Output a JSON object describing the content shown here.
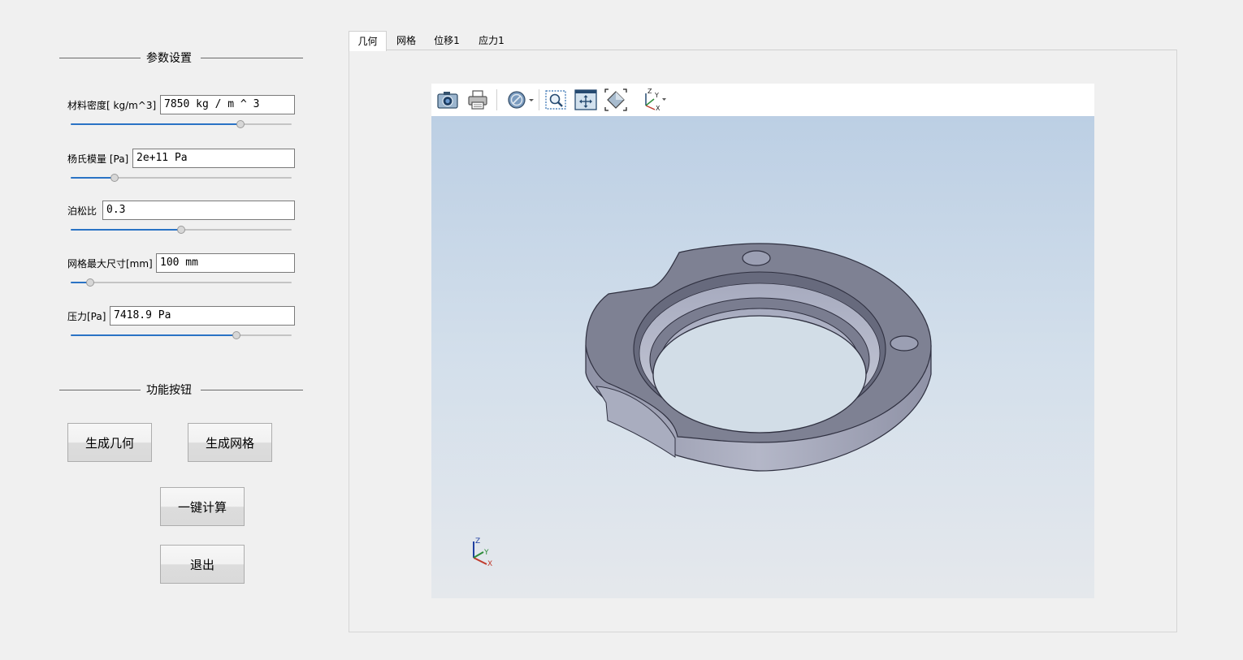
{
  "params_group": {
    "title": "参数设置"
  },
  "params": [
    {
      "label": "材料密度[ kg/m^3]",
      "value": "7850 kg / m ^ 3",
      "slider_fraction": 0.77
    },
    {
      "label": "杨氏模量 [Pa]",
      "value": "2e+11 Pa",
      "slider_fraction": 0.2
    },
    {
      "label": "泊松比",
      "value": "0.3",
      "slider_fraction": 0.5
    },
    {
      "label": "网格最大尺寸[mm]",
      "value": "100 mm",
      "slider_fraction": 0.09
    },
    {
      "label": "压力[Pa]",
      "value": "7418.9 Pa",
      "slider_fraction": 0.75
    }
  ],
  "buttons_group": {
    "title": "功能按钮"
  },
  "buttons": {
    "generate_geometry": "生成几何",
    "generate_mesh": "生成网格",
    "compute_all": "一键计算",
    "exit": "退出"
  },
  "tabs": [
    {
      "label": "几何",
      "active": true
    },
    {
      "label": "网格",
      "active": false
    },
    {
      "label": "位移1",
      "active": false
    },
    {
      "label": "应力1",
      "active": false
    }
  ],
  "viewer": {
    "toolbar_icons": [
      "camera-icon",
      "print-icon",
      "section-plane-icon",
      "zoom-window-icon",
      "fit-all-icon",
      "isometric-view-icon",
      "axes-orientation-icon"
    ],
    "axis_labels": {
      "x": "X",
      "y": "Y",
      "z": "Z"
    },
    "background_top": "#bccfe4",
    "background_bottom": "#e5e8ec",
    "model_color": "#7e8193"
  }
}
